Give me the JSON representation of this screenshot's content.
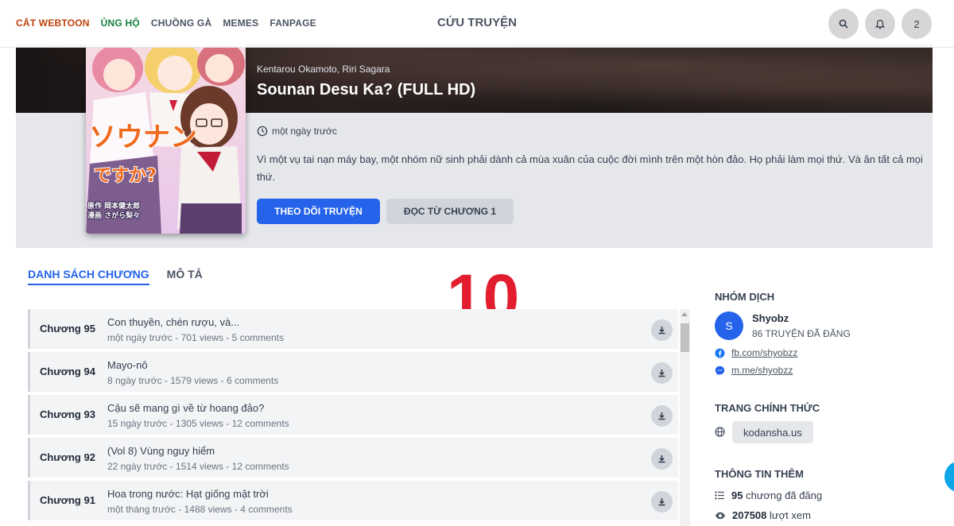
{
  "nav": {
    "links": [
      "CẮT WEBTOON",
      "ỦNG HỘ",
      "CHUỒNG GÀ",
      "MEMES",
      "FANPAGE"
    ],
    "site_title": "CỨU TRUYỆN",
    "notification_count": "2",
    "accent_colors": {
      "primary": "#2563eb",
      "link1": "#c2410c",
      "link2": "#15803d",
      "overlay_number": "#e11d2e"
    }
  },
  "manga": {
    "author": "Kentarou Okamoto, Riri Sagara",
    "title": "Sounan Desu Ka? (FULL HD)",
    "updated": "một ngày trước",
    "description": "Vì một vụ tai nạn máy bay, một nhóm nữ sinh phải dành cả mùa xuân của cuộc đời mình trên một hòn đảo. Họ phải làm mọi thứ. Và ăn tất cả mọi thứ.",
    "follow_label": "THEO DÕI TRUYỆN",
    "read_label": "ĐỌC TỪ CHƯƠNG 1",
    "cover_text": [
      "ソウナン",
      "ですか?",
      "原作 岡本健太郎",
      "漫画 さがら梨々"
    ]
  },
  "tabs": [
    "DANH SÁCH CHƯƠNG",
    "MÔ TẢ"
  ],
  "overlay_number": "10",
  "chapters": [
    {
      "num": "Chương 95",
      "name": "Con thuyền, chén rượu, và...",
      "meta": "một ngày trước - 701 views - 5 comments"
    },
    {
      "num": "Chương 94",
      "name": "Mayo-nô",
      "meta": "8 ngày trước - 1579 views - 6 comments"
    },
    {
      "num": "Chương 93",
      "name": "Cậu sẽ mang gì về từ hoang đảo?",
      "meta": "15 ngày trước - 1305 views - 12 comments"
    },
    {
      "num": "Chương 92",
      "name": "(Vol 8) Vùng nguy hiểm",
      "meta": "22 ngày trước - 1514 views - 12 comments"
    },
    {
      "num": "Chương 91",
      "name": "Hoa trong nước: Hạt giống mặt trời",
      "meta": "một tháng trước - 1488 views - 4 comments"
    }
  ],
  "sidebar": {
    "group_heading": "NHÓM DỊCH",
    "group_initial": "S",
    "group_name": "Shyobz",
    "group_count": "86 TRUYỆN ĐÃ ĐĂNG",
    "facebook": "fb.com/shyobzz",
    "messenger": "m.me/shyobzz",
    "official_heading": "TRANG CHÍNH THỨC",
    "official_site": "kodansha.us",
    "info_heading": "THÔNG TIN THÊM",
    "chapters_count": "95",
    "chapters_label": "chương đã đăng",
    "views_count": "207508",
    "views_label": "lượt xem"
  }
}
